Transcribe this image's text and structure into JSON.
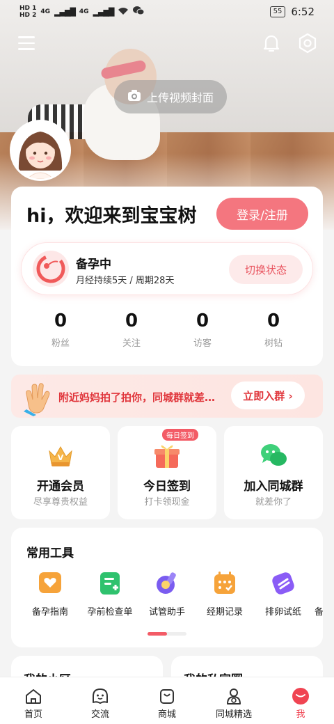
{
  "status_bar": {
    "sim1": "HD 1",
    "sim2": "HD 2",
    "network1": "4G",
    "network2": "4G",
    "battery": "55",
    "time": "6:52"
  },
  "header": {
    "upload_cover_label": "上传视频封面"
  },
  "profile": {
    "greeting": "hi，欢迎来到宝宝树",
    "login_label": "登录/注册",
    "state_title": "备孕中",
    "state_sub": "月经持续5天 / 周期28天",
    "switch_label": "切换状态",
    "stats": [
      {
        "value": "0",
        "label": "粉丝"
      },
      {
        "value": "0",
        "label": "关注"
      },
      {
        "value": "0",
        "label": "访客"
      },
      {
        "value": "0",
        "label": "树钻"
      }
    ]
  },
  "banner": {
    "text": "附近妈妈拍了拍你，同城群就差…",
    "button": "立即入群 ›"
  },
  "features": [
    {
      "title": "开通会员",
      "sub": "尽享尊贵权益",
      "icon": "crown-icon"
    },
    {
      "title": "今日签到",
      "sub": "打卡领现金",
      "icon": "gift-icon",
      "badge": "每日签到"
    },
    {
      "title": "加入同城群",
      "sub": "就差你了",
      "icon": "chat-icon"
    }
  ],
  "tools": {
    "title": "常用工具",
    "items": [
      {
        "label": "备孕指南",
        "icon": "heart-guide-icon",
        "color": "#f6a33a"
      },
      {
        "label": "孕前检查单",
        "icon": "checklist-icon",
        "color": "#2fc26e"
      },
      {
        "label": "试管助手",
        "icon": "test-tube-icon",
        "color": "#7a5cf0"
      },
      {
        "label": "经期记录",
        "icon": "calendar-icon",
        "color": "#f6a33a"
      },
      {
        "label": "排卵试纸",
        "icon": "test-strip-icon",
        "color": "#8a5cf6"
      },
      {
        "label": "备",
        "icon": "more-tool-icon",
        "color": "#f35b66"
      }
    ]
  },
  "bottom_cards": {
    "left": "我的小区",
    "right": "我的私家圈"
  },
  "tabbar": {
    "items": [
      {
        "label": "首页",
        "icon": "home-icon"
      },
      {
        "label": "交流",
        "icon": "community-icon"
      },
      {
        "label": "商城",
        "icon": "shopping-bag-icon"
      },
      {
        "label": "同城精选",
        "icon": "local-icon"
      },
      {
        "label": "我",
        "icon": "me-icon"
      }
    ],
    "active_index": 4,
    "accent_color": "#f04452"
  }
}
